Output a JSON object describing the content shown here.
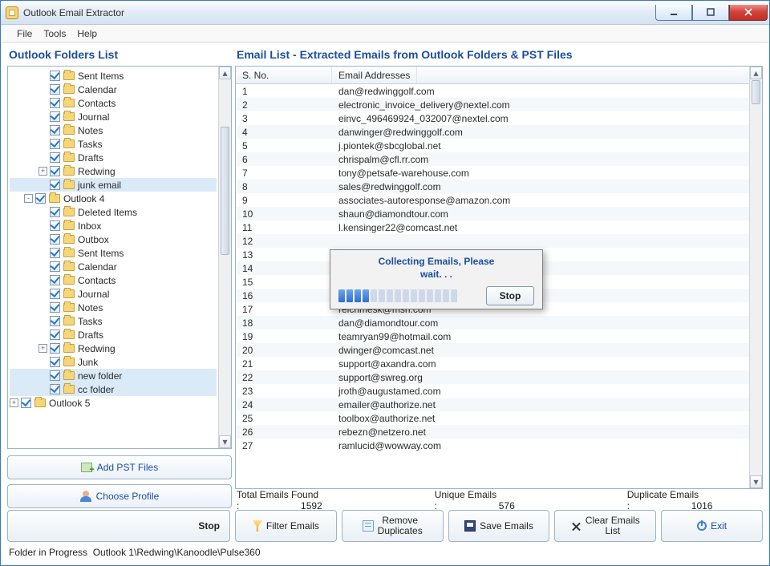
{
  "window": {
    "title": "Outlook Email Extractor"
  },
  "menubar": [
    "File",
    "Tools",
    "Help"
  ],
  "left_panel": {
    "title": "Outlook Folders List",
    "tree": [
      {
        "indent": 2,
        "expander": "",
        "checked": true,
        "label": "Sent Items"
      },
      {
        "indent": 2,
        "expander": "",
        "checked": true,
        "label": "Calendar"
      },
      {
        "indent": 2,
        "expander": "",
        "checked": true,
        "label": "Contacts"
      },
      {
        "indent": 2,
        "expander": "",
        "checked": true,
        "label": "Journal"
      },
      {
        "indent": 2,
        "expander": "",
        "checked": true,
        "label": "Notes"
      },
      {
        "indent": 2,
        "expander": "",
        "checked": true,
        "label": "Tasks"
      },
      {
        "indent": 2,
        "expander": "",
        "checked": true,
        "label": "Drafts"
      },
      {
        "indent": 2,
        "expander": "+",
        "checked": true,
        "label": "Redwing"
      },
      {
        "indent": 2,
        "expander": "",
        "checked": true,
        "label": "junk email",
        "sel": true
      },
      {
        "indent": 1,
        "expander": "-",
        "checked": true,
        "label": "Outlook 4"
      },
      {
        "indent": 2,
        "expander": "",
        "checked": true,
        "label": "Deleted Items"
      },
      {
        "indent": 2,
        "expander": "",
        "checked": true,
        "label": "Inbox"
      },
      {
        "indent": 2,
        "expander": "",
        "checked": true,
        "label": "Outbox"
      },
      {
        "indent": 2,
        "expander": "",
        "checked": true,
        "label": "Sent Items"
      },
      {
        "indent": 2,
        "expander": "",
        "checked": true,
        "label": "Calendar"
      },
      {
        "indent": 2,
        "expander": "",
        "checked": true,
        "label": "Contacts"
      },
      {
        "indent": 2,
        "expander": "",
        "checked": true,
        "label": "Journal"
      },
      {
        "indent": 2,
        "expander": "",
        "checked": true,
        "label": "Notes"
      },
      {
        "indent": 2,
        "expander": "",
        "checked": true,
        "label": "Tasks"
      },
      {
        "indent": 2,
        "expander": "",
        "checked": true,
        "label": "Drafts"
      },
      {
        "indent": 2,
        "expander": "+",
        "checked": true,
        "label": "Redwing"
      },
      {
        "indent": 2,
        "expander": "",
        "checked": true,
        "label": "Junk"
      },
      {
        "indent": 2,
        "expander": "",
        "checked": true,
        "label": "new folder",
        "sel": true
      },
      {
        "indent": 2,
        "expander": "",
        "checked": true,
        "label": "cc folder",
        "sel": true
      },
      {
        "indent": 0,
        "expander": "+",
        "checked": true,
        "label": "Outlook 5"
      }
    ],
    "buttons": {
      "add_pst": "Add PST Files",
      "choose_profile": "Choose Profile"
    }
  },
  "right_panel": {
    "title": "Email List - Extracted Emails from Outlook Folders & PST Files",
    "columns": {
      "sn": "S. No.",
      "email": "Email Addresses"
    },
    "rows": [
      {
        "n": "1",
        "e": "dan@redwinggolf.com"
      },
      {
        "n": "2",
        "e": "electronic_invoice_delivery@nextel.com"
      },
      {
        "n": "3",
        "e": "einvc_496469924_032007@nextel.com"
      },
      {
        "n": "4",
        "e": "danwinger@redwinggolf.com"
      },
      {
        "n": "5",
        "e": "j.piontek@sbcglobal.net"
      },
      {
        "n": "6",
        "e": "chrispalm@cfl.rr.com"
      },
      {
        "n": "7",
        "e": "tony@petsafe-warehouse.com"
      },
      {
        "n": "8",
        "e": "sales@redwinggolf.com"
      },
      {
        "n": "9",
        "e": "associates-autoresponse@amazon.com"
      },
      {
        "n": "10",
        "e": "shaun@diamondtour.com"
      },
      {
        "n": "11",
        "e": "l.kensinger22@comcast.net"
      },
      {
        "n": "12",
        "e": ""
      },
      {
        "n": "13",
        "e": ""
      },
      {
        "n": "14",
        "e": ""
      },
      {
        "n": "15",
        "e": ""
      },
      {
        "n": "16",
        "e": ""
      },
      {
        "n": "17",
        "e": "reichmesk@msn.com"
      },
      {
        "n": "18",
        "e": "dan@diamondtour.com"
      },
      {
        "n": "19",
        "e": "teamryan99@hotmail.com"
      },
      {
        "n": "20",
        "e": "dwinger@comcast.net"
      },
      {
        "n": "21",
        "e": "support@axandra.com"
      },
      {
        "n": "22",
        "e": "support@swreg.org"
      },
      {
        "n": "23",
        "e": "jroth@augustamed.com"
      },
      {
        "n": "24",
        "e": "emailer@authorize.net"
      },
      {
        "n": "25",
        "e": "toolbox@authorize.net"
      },
      {
        "n": "26",
        "e": "rebezn@netzero.net"
      },
      {
        "n": "27",
        "e": "ramlucid@wowway.com"
      }
    ]
  },
  "stats": {
    "total_label": "Total Emails Found :",
    "total_value": "1592",
    "unique_label": "Unique Emails :",
    "unique_value": "576",
    "dup_label": "Duplicate Emails :",
    "dup_value": "1016"
  },
  "bottombar": {
    "stop": "Stop",
    "filter": "Filter Emails",
    "remove_l1": "Remove",
    "remove_l2": "Duplicates",
    "save": "Save Emails",
    "clear_l1": "Clear Emails",
    "clear_l2": "List",
    "exit": "Exit"
  },
  "footer": {
    "label": "Folder in Progress",
    "path": "Outlook 1\\Redwing\\Kanoodle\\Pulse360"
  },
  "modal": {
    "title_l1": "Collecting Emails, Please",
    "title_l2": "wait. . .",
    "stop": "Stop",
    "active": 4,
    "total": 15
  }
}
